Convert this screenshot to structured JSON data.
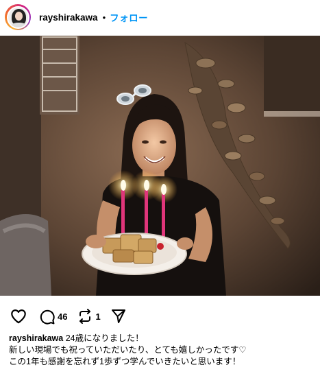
{
  "post": {
    "username": "rayshirakawa",
    "separator": "•",
    "follow_label": "フォロー",
    "comment_count": "46",
    "repost_count": "1",
    "caption_line1": "24歳になりました！",
    "caption_line2": "新しい現場でも祝っていただいたり、とても嬉しかったです♡",
    "caption_line3": "この1年も感謝を忘れず1歩ずつ学んでいきたいと思います！"
  },
  "colors": {
    "accent": "#0095f6",
    "text": "#000000",
    "background": "#ffffff"
  },
  "icons": {
    "like": "heart-icon",
    "comment": "comment-icon",
    "repost": "repost-icon",
    "share": "send-icon"
  }
}
